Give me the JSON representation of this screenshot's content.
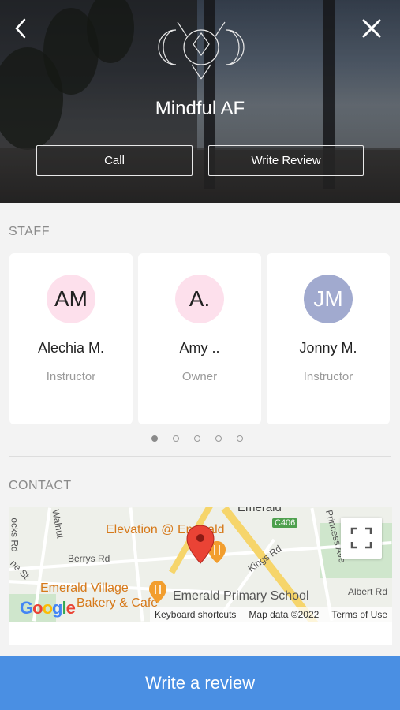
{
  "header": {
    "studio_name": "Mindful AF",
    "call_label": "Call",
    "write_review_label": "Write Review"
  },
  "staff": {
    "title": "STAFF",
    "members": [
      {
        "initials": "AM",
        "name": "Alechia M.",
        "role": "Instructor"
      },
      {
        "initials": "A.",
        "name": "Amy ..",
        "role": "Owner"
      },
      {
        "initials": "JM",
        "name": "Jonny M.",
        "role": "Instructor"
      }
    ],
    "page_count": 5,
    "active_page": 1
  },
  "contact": {
    "title": "CONTACT",
    "map": {
      "labels": {
        "elevation": "Elevation @ Emerald",
        "village": "Emerald Village",
        "bakery": "Bakery & Cafe",
        "school": "Emerald Primary School",
        "road_badge": "C406",
        "berrys": "Berrys Rd",
        "kings": "Kings Rd",
        "princess": "Princess Ave",
        "albert": "Albert Rd",
        "walnut": "Walnut",
        "locks": "ocks Rd",
        "ne_st": "ne St",
        "emerald_top": "Emerald"
      },
      "google": "Google",
      "keyboard_shortcuts": "Keyboard shortcuts",
      "map_data": "Map data ©2022",
      "terms": "Terms of Use"
    }
  },
  "bottom_button": "Write a review",
  "colors": {
    "primary": "#4a8fe3",
    "avatar_pink": "#fde0ec",
    "avatar_blue": "#a1aacf",
    "pin_red": "#ea4335"
  }
}
